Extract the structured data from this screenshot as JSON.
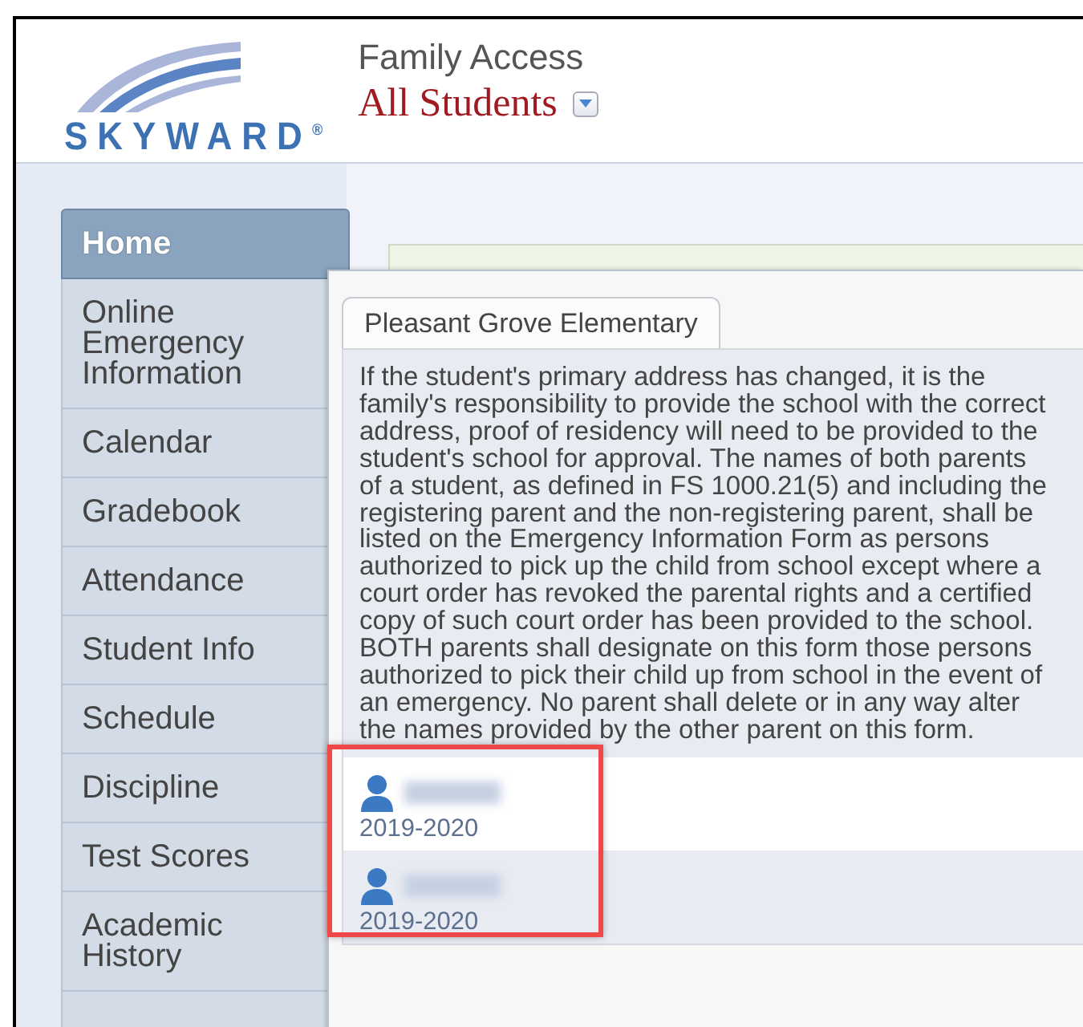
{
  "header": {
    "logo_text": "SKYWARD$^{®}$",
    "app_title": "Family Access",
    "student_selector": "All Students"
  },
  "sidebar": {
    "items": [
      {
        "label": "Home",
        "selected": true
      },
      {
        "label": "Online Emergency Information",
        "selected": false
      },
      {
        "label": "Calendar",
        "selected": false
      },
      {
        "label": "Gradebook",
        "selected": false
      },
      {
        "label": "Attendance",
        "selected": false
      },
      {
        "label": "Student Info",
        "selected": false
      },
      {
        "label": "Schedule",
        "selected": false
      },
      {
        "label": "Discipline",
        "selected": false
      },
      {
        "label": "Test Scores",
        "selected": false
      },
      {
        "label": "Academic History",
        "selected": false
      }
    ]
  },
  "popup": {
    "tab": "Pleasant Grove Elementary",
    "notice": "If the student's primary address has changed, it is the family's responsibility to provide the school with the correct address, proof of residency will need to be provided to the student's school for approval. The names of both parents of a student, as defined in FS 1000.21(5) and including the registering parent and the non-registering parent, shall be listed on the Emergency Information Form as persons authorized to pick up the child from school except where a court order has revoked the parental rights and a certified copy of such court order has been provided to the school. BOTH parents shall designate on this form those persons authorized to pick their child up from school in the event of an emergency. No parent shall delete or in any way alter the names provided by the other parent on this form.",
    "students": [
      {
        "year": "2019-2020"
      },
      {
        "year": "2019-2020"
      }
    ]
  }
}
